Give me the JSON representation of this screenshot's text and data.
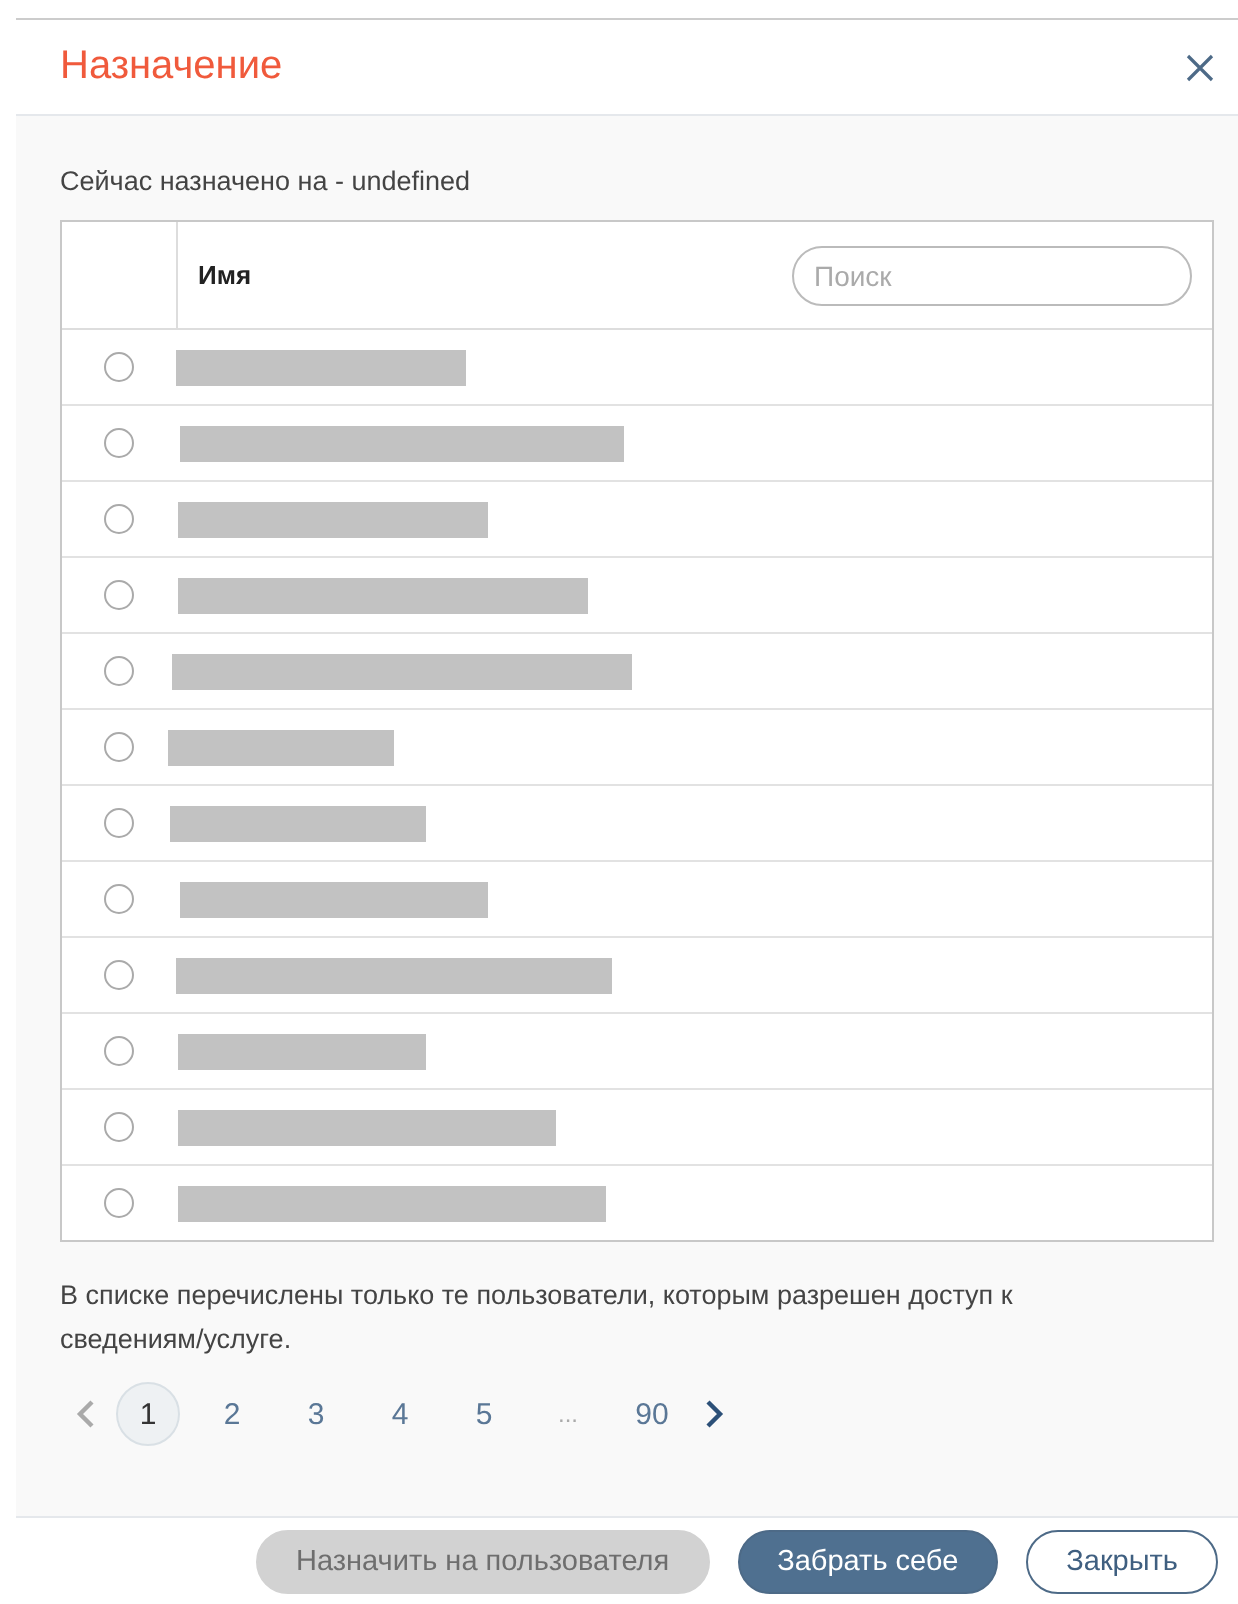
{
  "dialog": {
    "title": "Назначение"
  },
  "current_assignee": "Сейчас назначено на - undefined",
  "table": {
    "columns": [
      {
        "label": "Имя"
      }
    ],
    "search": {
      "placeholder": "Поиск"
    },
    "rows": [
      {
        "selected": false
      },
      {
        "selected": false
      },
      {
        "selected": false
      },
      {
        "selected": false
      },
      {
        "selected": false
      },
      {
        "selected": false
      },
      {
        "selected": false
      },
      {
        "selected": false
      },
      {
        "selected": false
      },
      {
        "selected": false
      },
      {
        "selected": false
      },
      {
        "selected": false
      }
    ]
  },
  "note": "В списке перечислены только те пользователи, которым разрешен доступ к сведениям/услуге.",
  "pagination": {
    "prev_disabled": true,
    "next_disabled": false,
    "pages": [
      {
        "kind": "page",
        "label": "1",
        "selected": true
      },
      {
        "kind": "page",
        "label": "2",
        "selected": false
      },
      {
        "kind": "page",
        "label": "3",
        "selected": false
      },
      {
        "kind": "page",
        "label": "4",
        "selected": false
      },
      {
        "kind": "page",
        "label": "5",
        "selected": false
      },
      {
        "kind": "ellipsis",
        "label": "..."
      },
      {
        "kind": "page",
        "label": "90",
        "selected": false
      }
    ]
  },
  "buttons": [
    {
      "label": "Назначить на пользователя",
      "kind": "secondary",
      "disabled": true
    },
    {
      "label": "Забрать себе",
      "kind": "primary",
      "disabled": false
    },
    {
      "label": "Закрыть",
      "kind": "outline",
      "disabled": false
    }
  ]
}
